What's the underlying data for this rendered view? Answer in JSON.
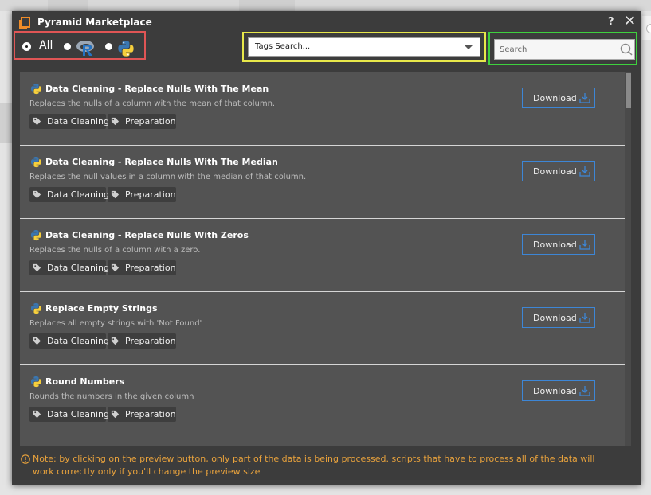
{
  "window": {
    "title": "Pyramid Marketplace",
    "help_label": "?",
    "close_label": "✕"
  },
  "filters": {
    "all_label": "All",
    "selected": "All",
    "options": [
      "All",
      "R",
      "Python"
    ]
  },
  "tags_search": {
    "label": "Tags Search..."
  },
  "search": {
    "placeholder": "Search",
    "value": ""
  },
  "items": [
    {
      "title": "Data Cleaning - Replace Nulls With The Mean",
      "description": "Replaces the nulls of a column with the mean of that column.",
      "tags": [
        "Data Cleaning",
        "Preparation"
      ],
      "download_label": "Download"
    },
    {
      "title": "Data Cleaning - Replace Nulls With The Median",
      "description": "Replaces the null values in a column with the median of that column.",
      "tags": [
        "Data Cleaning",
        "Preparation"
      ],
      "download_label": "Download"
    },
    {
      "title": "Data Cleaning - Replace Nulls With Zeros",
      "description": "Replaces the nulls of a column with a zero.",
      "tags": [
        "Data Cleaning",
        "Preparation"
      ],
      "download_label": "Download"
    },
    {
      "title": "Replace Empty Strings",
      "description": "Replaces all empty strings with 'Not Found'",
      "tags": [
        "Data Cleaning",
        "Preparation"
      ],
      "download_label": "Download"
    },
    {
      "title": "Round Numbers",
      "description": "Rounds the numbers in the given column",
      "tags": [
        "Data Cleaning",
        "Preparation"
      ],
      "download_label": "Download"
    }
  ],
  "notice": {
    "text": "Note: by clicking on the preview button, only part of the data is being processed. scripts that have to process all of the data will work correctly only if you'll change the preview size"
  },
  "colors": {
    "dialog_bg": "#3c3c3c",
    "list_bg": "#535353",
    "accent_blue": "#3d86d6",
    "notice_orange": "#e8a23c",
    "highlight_red": "#e05555",
    "highlight_yellow": "#e8e84a",
    "highlight_green": "#3ed13e"
  }
}
